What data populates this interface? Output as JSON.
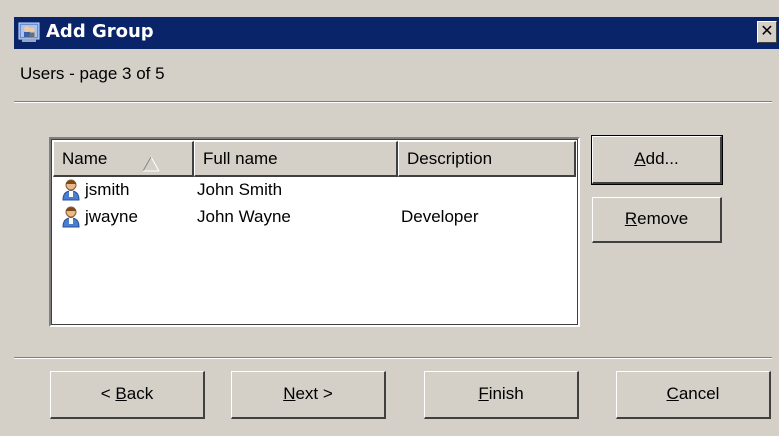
{
  "window": {
    "title": "Add Group",
    "close_glyph": "✕",
    "icon": "add-group-icon"
  },
  "subheader": "Users - page 3 of 5",
  "listview": {
    "columns": [
      {
        "label": "Name",
        "sorted": "ascending"
      },
      {
        "label": "Full name"
      },
      {
        "label": "Description"
      }
    ],
    "rows": [
      {
        "icon": "user-icon",
        "name": "jsmith",
        "full_name": "John Smith",
        "description": ""
      },
      {
        "icon": "user-icon",
        "name": "jwayne",
        "full_name": "John Wayne",
        "description": "Developer"
      }
    ]
  },
  "side_buttons": {
    "add": {
      "label": "Add...",
      "mnemonic": "A",
      "rest": "dd..."
    },
    "remove": {
      "label": "Remove",
      "mnemonic": "R",
      "rest": "emove"
    }
  },
  "nav_buttons": {
    "back": {
      "prefix": "< ",
      "mnemonic": "B",
      "rest": "ack"
    },
    "next": {
      "prefix": "",
      "mnemonic": "N",
      "rest": "ext >"
    },
    "finish": {
      "prefix": "",
      "mnemonic": "F",
      "rest": "inish"
    },
    "cancel": {
      "prefix": "",
      "mnemonic": "C",
      "rest": "ancel"
    }
  },
  "colors": {
    "titlebar": "#0a246a",
    "face": "#d4d0c8"
  }
}
